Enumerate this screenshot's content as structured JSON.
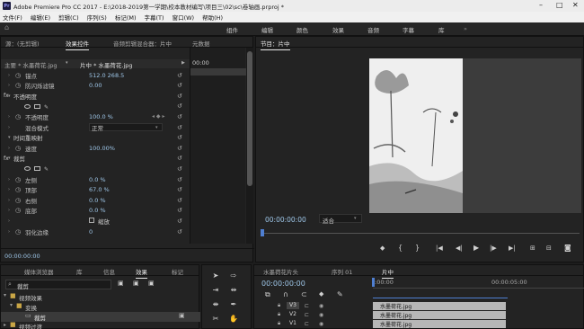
{
  "titlebar": {
    "logo": "Pr",
    "title": "Adobe Premiere Pro CC 2017 - E:\\2018-2019第一学期\\校本教材编写\\项目三\\02\\sc\\卷轴画.prproj *"
  },
  "menubar": [
    "文件(F)",
    "编辑(E)",
    "剪辑(C)",
    "序列(S)",
    "标记(M)",
    "字幕(T)",
    "窗口(W)",
    "帮助(H)"
  ],
  "workspaces": [
    "组件",
    "编辑",
    "颜色",
    "效果",
    "音频",
    "字幕",
    "库"
  ],
  "effect_panel": {
    "tabs": [
      "源：(无剪辑)",
      "效果控件",
      "音频剪辑混合器：片中",
      "元数据"
    ],
    "master_label": "主要 * 水墨荷花.jpg",
    "clip_label": "片中 * 水墨荷花.jpg",
    "timecode": "00:00",
    "rows": [
      {
        "label": "锚点",
        "value": "512.0    268.5",
        "icon": "stopwatch-icon"
      },
      {
        "label": "防闪烁滤镜",
        "value": "0.00",
        "icon": "stopwatch-icon"
      },
      {
        "label": "不透明度",
        "section": true,
        "fx": "fx"
      },
      {
        "label": "",
        "shapes": true
      },
      {
        "label": "不透明度",
        "value": "100.0 %",
        "icon": "stopwatch-icon"
      },
      {
        "label": "混合模式",
        "value": "正常",
        "dropdown": true
      },
      {
        "label": "时间重映射",
        "section": true,
        "fx": ""
      },
      {
        "label": "速度",
        "value": "100.00%",
        "icon": "stopwatch-icon"
      },
      {
        "label": "裁剪",
        "section": true,
        "fx": "fx"
      },
      {
        "label": "",
        "shapes": true
      },
      {
        "label": "左侧",
        "value": "0.0 %",
        "icon": "stopwatch-icon"
      },
      {
        "label": "顶部",
        "value": "67.0 %",
        "icon": "stopwatch-icon"
      },
      {
        "label": "右侧",
        "value": "0.0 %",
        "icon": "stopwatch-icon"
      },
      {
        "label": "底部",
        "value": "0.0 %",
        "icon": "stopwatch-icon"
      },
      {
        "label": "",
        "value": "缩放",
        "checkbox": true
      },
      {
        "label": "羽化边缘",
        "value": "0",
        "icon": "stopwatch-icon"
      }
    ],
    "footer_time": "00:00:00:00"
  },
  "program": {
    "tab": "节目：片中",
    "timecode": "00:00:00:00",
    "fit": "适合"
  },
  "browser": {
    "tabs": [
      "媒体浏览器",
      "库",
      "信息",
      "效果",
      "标记"
    ],
    "search_value": "裁剪",
    "tree": [
      {
        "label": "视频效果",
        "level": 0
      },
      {
        "label": "变换",
        "level": 1
      },
      {
        "label": "裁剪",
        "level": 2
      },
      {
        "label": "视频过渡",
        "level": 0
      }
    ]
  },
  "timeline": {
    "tabs": [
      "水墨荷花片头",
      "序列 01",
      "片中"
    ],
    "timecode": "00:00:00:00",
    "ruler": [
      ":00:00",
      "00:00:05:00"
    ],
    "tracks": [
      {
        "name": "V3",
        "clip": "水墨荷花.jpg"
      },
      {
        "name": "V2",
        "clip": "水墨荷花.jpg"
      },
      {
        "name": "V1",
        "clip": "水墨荷花.jpg"
      }
    ]
  },
  "colors": {
    "accent": "#9ec6e8",
    "playhead": "#4f7fd1"
  }
}
